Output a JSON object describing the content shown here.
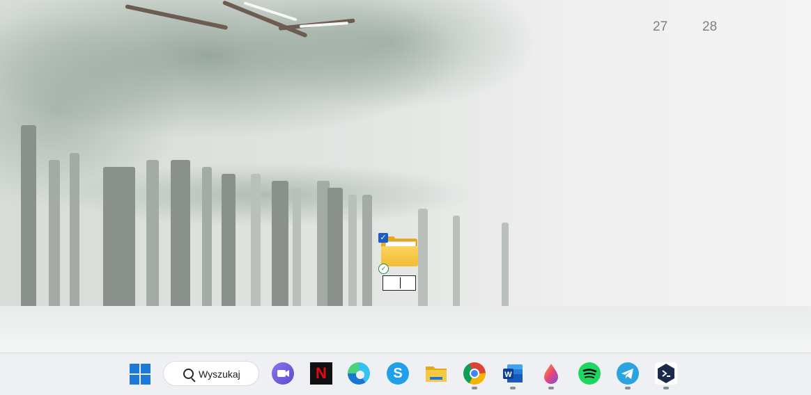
{
  "widget": {
    "days": [
      "27",
      "28"
    ]
  },
  "desktop": {
    "folder": {
      "icon": "folder-icon",
      "rename_value": ""
    }
  },
  "taskbar": {
    "search": {
      "label": "Wyszukaj",
      "icon": "search-icon"
    },
    "apps": [
      {
        "name": "start",
        "icon": "windows-logo-icon",
        "color": "#1e78d7"
      },
      {
        "name": "teams-chat",
        "icon": "video-chat-icon",
        "color": "#6e5cd6"
      },
      {
        "name": "netflix",
        "icon": "netflix-icon",
        "color": "#e50914",
        "glyph": "N"
      },
      {
        "name": "edge",
        "icon": "edge-browser-icon",
        "color": "#1f9bdd"
      },
      {
        "name": "skype",
        "icon": "skype-icon",
        "color": "#1fa0e8",
        "glyph": "S"
      },
      {
        "name": "file-explorer",
        "icon": "folder-icon",
        "color": "#f2bd33"
      },
      {
        "name": "chrome",
        "icon": "chrome-icon",
        "color": "#db4437"
      },
      {
        "name": "word",
        "icon": "word-icon",
        "color": "#185abd",
        "glyph": "W"
      },
      {
        "name": "paint",
        "icon": "paint-drop-icon",
        "color": "#e8457a"
      },
      {
        "name": "spotify",
        "icon": "spotify-icon",
        "color": "#1ed760"
      },
      {
        "name": "telegram",
        "icon": "telegram-icon",
        "color": "#2aa3df"
      },
      {
        "name": "terminal",
        "icon": "terminal-prompt-icon",
        "color": "#1b2a4a"
      }
    ]
  }
}
